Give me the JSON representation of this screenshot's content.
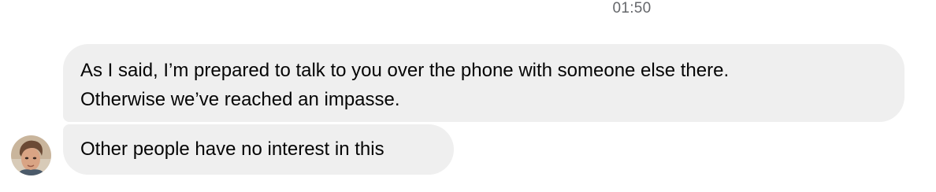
{
  "chat": {
    "timestamp": "01:50",
    "messages": [
      {
        "lines": [
          "As I said, I’m prepared to talk to you over the phone with someone else there.",
          "Otherwise we’ve reached an impasse."
        ]
      },
      {
        "text": "Other people have no interest in this"
      }
    ],
    "colors": {
      "bubble_background": "#efefef",
      "text": "#050505",
      "timestamp": "#65676b"
    }
  }
}
